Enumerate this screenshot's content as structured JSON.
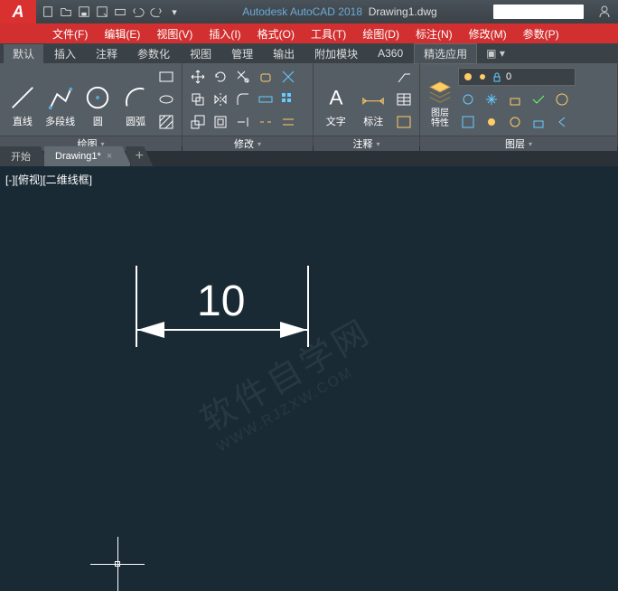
{
  "title": {
    "app": "Autodesk AutoCAD 2018",
    "doc": "Drawing1.dwg"
  },
  "logo": "A",
  "menus": [
    "文件(F)",
    "编辑(E)",
    "视图(V)",
    "插入(I)",
    "格式(O)",
    "工具(T)",
    "绘图(D)",
    "标注(N)",
    "修改(M)",
    "参数(P)"
  ],
  "ribbonTabs": [
    "默认",
    "插入",
    "注释",
    "参数化",
    "视图",
    "管理",
    "输出",
    "附加模块",
    "A360"
  ],
  "ribbonExtra": "精选应用",
  "panels": {
    "draw": {
      "label": "绘图",
      "line": "直线",
      "polyline": "多段线",
      "circle": "圆",
      "arc": "圆弧"
    },
    "modify": {
      "label": "修改"
    },
    "annot": {
      "label": "注释",
      "text": "文字",
      "dim": "标注"
    },
    "layers": {
      "label": "图层",
      "props": "图层\n特性",
      "current": "0"
    }
  },
  "docTabs": {
    "start": "开始",
    "drawing": "Drawing1*",
    "add": "+"
  },
  "viewport": "[-][俯视][二维线框]",
  "dimension": "10",
  "watermark": {
    "main": "软件自学网",
    "sub": "WWW.RJZXW.COM"
  }
}
